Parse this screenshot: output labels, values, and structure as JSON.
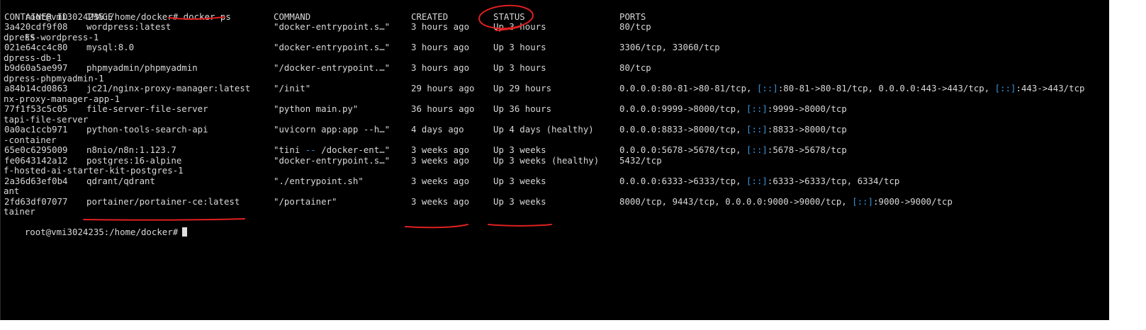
{
  "prompt": "root@vmi3024235:/home/docker#",
  "command": "docker ps",
  "headers": {
    "id": "CONTAINER ID",
    "image": "IMAGE",
    "command": "COMMAND",
    "created": "CREATED",
    "status": "STATUS",
    "ports": "PORTS"
  },
  "wrapped_header_tail": "ES",
  "rows": [
    {
      "id": "3a420cdf9f08",
      "image": "wordpress:latest",
      "command": "\"docker-entrypoint.s…\"",
      "created": "3 hours ago",
      "status": "Up 3 hours",
      "ports": [
        {
          "t": "80/tcp"
        }
      ],
      "name_tail": "dpress-wordpress-1"
    },
    {
      "id": "021e64cc4c80",
      "image": "mysql:8.0",
      "command": "\"docker-entrypoint.s…\"",
      "created": "3 hours ago",
      "status": "Up 3 hours",
      "ports": [
        {
          "t": "3306/tcp, 33060/tcp"
        }
      ],
      "name_tail": "dpress-db-1"
    },
    {
      "id": "b9d60a5ae997",
      "image": "phpmyadmin/phpmyadmin",
      "command": "\"/docker-entrypoint.…\"",
      "created": "3 hours ago",
      "status": "Up 3 hours",
      "ports": [
        {
          "t": "80/tcp"
        }
      ],
      "name_tail": "dpress-phpmyadmin-1"
    },
    {
      "id": "a84b14cd0863",
      "image": "jc21/nginx-proxy-manager:latest",
      "command": "\"/init\"",
      "created": "29 hours ago",
      "status": "Up 29 hours",
      "ports": [
        {
          "t": "0.0.0.0:80-81->80-81/tcp, "
        },
        {
          "t": "[::]",
          "blue": true
        },
        {
          "t": ":80-81->80-81/tcp, 0.0.0.0:443->443/tcp, "
        },
        {
          "t": "[::]",
          "blue": true
        },
        {
          "t": ":443->443/tcp"
        }
      ],
      "name_tail": "nx-proxy-manager-app-1"
    },
    {
      "id": "77f1f53c5c05",
      "image": "file-server-file-server",
      "command": "\"python main.py\"",
      "created": "36 hours ago",
      "status": "Up 36 hours",
      "ports": [
        {
          "t": "0.0.0.0:9999->8000/tcp, "
        },
        {
          "t": "[::]",
          "blue": true
        },
        {
          "t": ":9999->8000/tcp"
        }
      ],
      "name_tail": "tapi-file-server"
    },
    {
      "id": "0a0ac1ccb971",
      "image": "python-tools-search-api",
      "command": "\"uvicorn app:app --h…\"",
      "created": "4 days ago",
      "status": "Up 4 days (healthy)",
      "ports": [
        {
          "t": "0.0.0.0:8833->8000/tcp, "
        },
        {
          "t": "[::]",
          "blue": true
        },
        {
          "t": ":8833->8000/tcp"
        }
      ],
      "name_tail": "-container"
    },
    {
      "id": "65e0c6295009",
      "image": "n8nio/n8n:1.123.7",
      "command_parts": [
        {
          "t": "\"tini "
        },
        {
          "t": "--",
          "blue": true
        },
        {
          "t": " /docker-ent…\""
        }
      ],
      "created": "3 weeks ago",
      "status": "Up 3 weeks",
      "ports": [
        {
          "t": "0.0.0.0:5678->5678/tcp, "
        },
        {
          "t": "[::]",
          "blue": true
        },
        {
          "t": ":5678->5678/tcp"
        }
      ],
      "name_tail": null
    },
    {
      "id": "fe0643142a12",
      "image": "postgres:16-alpine",
      "command": "\"docker-entrypoint.s…\"",
      "created": "3 weeks ago",
      "status": "Up 3 weeks (healthy)",
      "ports": [
        {
          "t": "5432/tcp"
        }
      ],
      "name_tail": "f-hosted-ai-starter-kit-postgres-1"
    },
    {
      "id": "2a36d63ef0b4",
      "image": "qdrant/qdrant",
      "command": "\"./entrypoint.sh\"",
      "created": "3 weeks ago",
      "status": "Up 3 weeks",
      "ports": [
        {
          "t": "0.0.0.0:6333->6333/tcp, "
        },
        {
          "t": "[::]",
          "blue": true
        },
        {
          "t": ":6333->6333/tcp, 6334/tcp"
        }
      ],
      "name_tail": "ant"
    },
    {
      "id": "2fd63df07077",
      "image": "portainer/portainer-ce:latest",
      "command": "\"/portainer\"",
      "created": "3 weeks ago",
      "status": "Up 3 weeks",
      "ports": [
        {
          "t": "8000/tcp, 9443/tcp, 0.0.0.0:9000->9000/tcp, "
        },
        {
          "t": "[::]",
          "blue": true
        },
        {
          "t": ":9000->9000/tcp"
        }
      ],
      "name_tail": "tainer"
    }
  ],
  "colors": {
    "background": "#000000",
    "text": "#d8d8d8",
    "ipv6_highlight": "#3a96dd",
    "annotation": "#e02020"
  }
}
